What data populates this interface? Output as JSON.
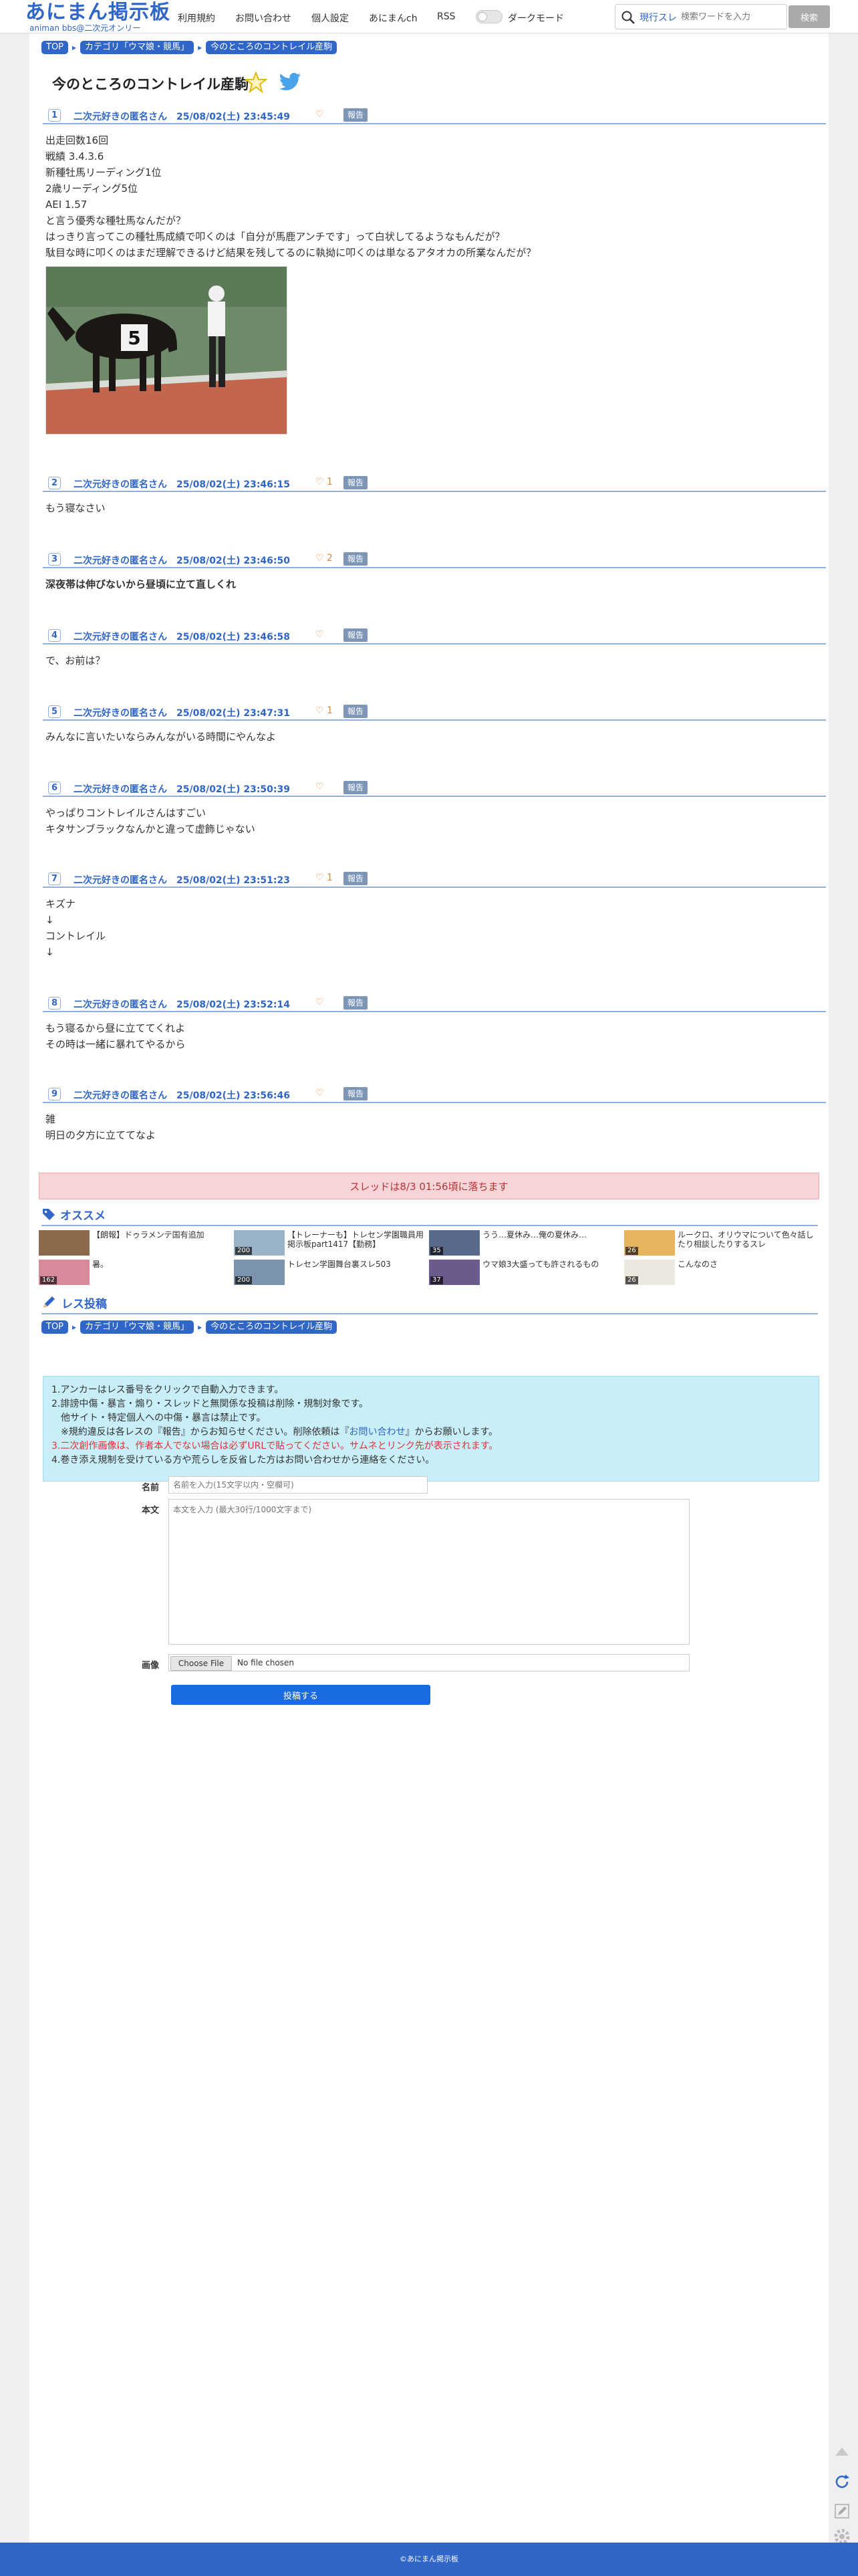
{
  "header": {
    "logo_main": "あにまん掲示板",
    "logo_sub": "animan bbs@二次元オンリー",
    "nav": [
      "利用規約",
      "お問い合わせ",
      "個人設定",
      "あにまんch",
      "RSS"
    ],
    "dark_mode_label": "ダークモード",
    "dark_mode_on": false,
    "search_scope": "現行スレ",
    "search_placeholder": "検索ワードを入力",
    "search_button": "検索"
  },
  "breadcrumb": {
    "top": "TOP",
    "category": "カテゴリ「ウマ娘・競馬」",
    "current": "今のところのコントレイル産駒"
  },
  "thread": {
    "title": "今のところのコントレイル産駒"
  },
  "posts": [
    {
      "num": "1",
      "name": "二次元好きの匿名さん",
      "date": "25/08/02(土) 23:45:49",
      "likes": "",
      "body": "出走回数16回\n戦績 3.4.3.6\n新種牡馬リーディング1位\n2歳リーディング5位\nAEI 1.57\nと言う優秀な種牡馬なんだが？\nはっきり言ってこの種牡馬成績で叩くのは「自分が馬鹿アンチです」って白状してるようなもんだが？\n駄目な時に叩くのはまだ理解できるけど結果を残してるのに執拗に叩くのは単なるアタオカの所業なんだが？",
      "bold": false
    },
    {
      "num": "2",
      "name": "二次元好きの匿名さん",
      "date": "25/08/02(土) 23:46:15",
      "likes": "1",
      "body": "もう寝なさい",
      "bold": false
    },
    {
      "num": "3",
      "name": "二次元好きの匿名さん",
      "date": "25/08/02(土) 23:46:50",
      "likes": "2",
      "body": "深夜帯は伸びないから昼頃に立て直しくれ",
      "bold": true
    },
    {
      "num": "4",
      "name": "二次元好きの匿名さん",
      "date": "25/08/02(土) 23:46:58",
      "likes": "",
      "body": "で、お前は？",
      "bold": false
    },
    {
      "num": "5",
      "name": "二次元好きの匿名さん",
      "date": "25/08/02(土) 23:47:31",
      "likes": "1",
      "body": "みんなに言いたいならみんながいる時間にやんなよ",
      "bold": false
    },
    {
      "num": "6",
      "name": "二次元好きの匿名さん",
      "date": "25/08/02(土) 23:50:39",
      "likes": "",
      "body": "やっぱりコントレイルさんはすごい\nキタサンブラックなんかと違って虚飾じゃない",
      "bold": false
    },
    {
      "num": "7",
      "name": "二次元好きの匿名さん",
      "date": "25/08/02(土) 23:51:23",
      "likes": "1",
      "body": "キズナ\n↓\nコントレイル\n↓",
      "bold": false
    },
    {
      "num": "8",
      "name": "二次元好きの匿名さん",
      "date": "25/08/02(土) 23:52:14",
      "likes": "",
      "body": "もう寝るから昼に立ててくれよ\nその時は一緒に暴れてやるから",
      "bold": false
    },
    {
      "num": "9",
      "name": "二次元好きの匿名さん",
      "date": "25/08/02(土) 23:56:46",
      "likes": "",
      "body": "雑\n明日の夕方に立ててなよ",
      "bold": false
    }
  ],
  "report_label": "報告",
  "expire_notice": "スレッドは8/3 01:56頃に落ちます",
  "recommend": {
    "heading": "オススメ",
    "items": [
      {
        "count": "",
        "title": "【朗報】ドゥラメンテ国有追加"
      },
      {
        "count": "200",
        "title": "【トレーナーも】トレセン学園職員用掲示板part1417【勤務】"
      },
      {
        "count": "35",
        "title": "うう…夏休み…俺の夏休み…"
      },
      {
        "count": "26",
        "title": "ルークロ、オリウマについて色々話したり相談したりするスレ"
      },
      {
        "count": "162",
        "title": "暑。"
      },
      {
        "count": "200",
        "title": "トレセン学園舞台裏スレ503"
      },
      {
        "count": "37",
        "title": "ウマ娘3大盛っても許されるもの"
      },
      {
        "count": "26",
        "title": "こんなのさ"
      }
    ]
  },
  "reply": {
    "heading": "レス投稿",
    "rules": [
      [
        {
          "t": "1.アンカーはレス番号をクリックで自動入力できます。",
          "c": ""
        }
      ],
      [
        {
          "t": "2.誹謗中傷・暴言・煽り・スレッドと無関係な投稿は削除・規制対象です。",
          "c": ""
        }
      ],
      [
        {
          "t": "　他サイト・特定個人への中傷・暴言は禁止です。",
          "c": ""
        }
      ],
      [
        {
          "t": "　※規約違反は各レスの『報告』からお知らせください。削除依頼は『",
          "c": ""
        },
        {
          "t": "お問い合わせ",
          "c": "blue"
        },
        {
          "t": "』からお願いします。",
          "c": ""
        }
      ],
      [
        {
          "t": "3.二次創作画像は、作者本人でない場合は必ずURLで貼ってください。サムネとリンク先が表示されます。",
          "c": "red"
        }
      ],
      [
        {
          "t": "4.巻き添え規制を受けている方や荒らしを反省した方はお問い合わせから連絡をください。",
          "c": ""
        }
      ]
    ],
    "name_label": "名前",
    "name_placeholder": "名前を入力(15文字以内・空欄可)",
    "body_label": "本文",
    "body_placeholder": "本文を入力 (最大30行/1000文字まで)",
    "image_label": "画像",
    "file_button": "Choose File",
    "file_status": "No file chosen",
    "submit": "投稿する"
  },
  "footer": {
    "copyright": "©あにまん掲示板"
  },
  "colors": {
    "accent": "#2f66c7",
    "report": "#7d96b8",
    "expire_bg": "#f6d5d8",
    "rules_bg": "#c8eef8",
    "submit": "#1a6ae0"
  },
  "icons": [
    "search-icon",
    "star-icon",
    "twitter-icon",
    "heart-icon",
    "tag-icon",
    "pencil-icon",
    "scroll-top-icon",
    "refresh-icon",
    "edit-icon",
    "gear-icon"
  ]
}
